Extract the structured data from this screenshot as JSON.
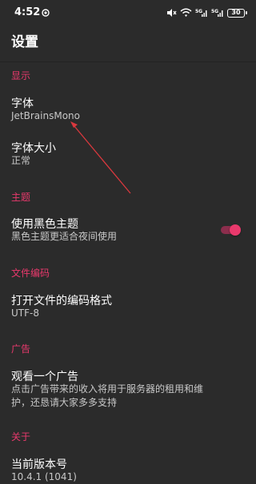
{
  "status_bar": {
    "time": "4:52",
    "battery": "30",
    "icons": [
      "whatsapp-icon",
      "mute-icon",
      "wifi-icon",
      "signal-5g-icon",
      "signal-5g-icon",
      "battery-icon"
    ]
  },
  "app_bar": {
    "title": "设置"
  },
  "sections": {
    "display": {
      "header": "显示",
      "font": {
        "title": "字体",
        "summary": "JetBrainsMono"
      },
      "font_size": {
        "title": "字体大小",
        "summary": "正常"
      }
    },
    "theme": {
      "header": "主题",
      "dark_theme": {
        "title": "使用黑色主题",
        "summary": "黑色主题更适合夜间使用",
        "enabled": true
      }
    },
    "encoding": {
      "header": "文件编码",
      "open_encoding": {
        "title": "打开文件的编码格式",
        "summary": "UTF-8"
      }
    },
    "ads": {
      "header": "广告",
      "watch_ad": {
        "title": "观看一个广告",
        "summary_line1": "点击广告带来的收入将用于服务器的租用和维",
        "summary_line2": "护，还恳请大家多多支持"
      }
    },
    "about": {
      "header": "关于",
      "version": {
        "title": "当前版本号",
        "summary": "10.4.1 (1041)"
      }
    }
  },
  "colors": {
    "accent": "#e9396c",
    "background": "#2b2b2b",
    "annotation_arrow": "#d9383e"
  }
}
